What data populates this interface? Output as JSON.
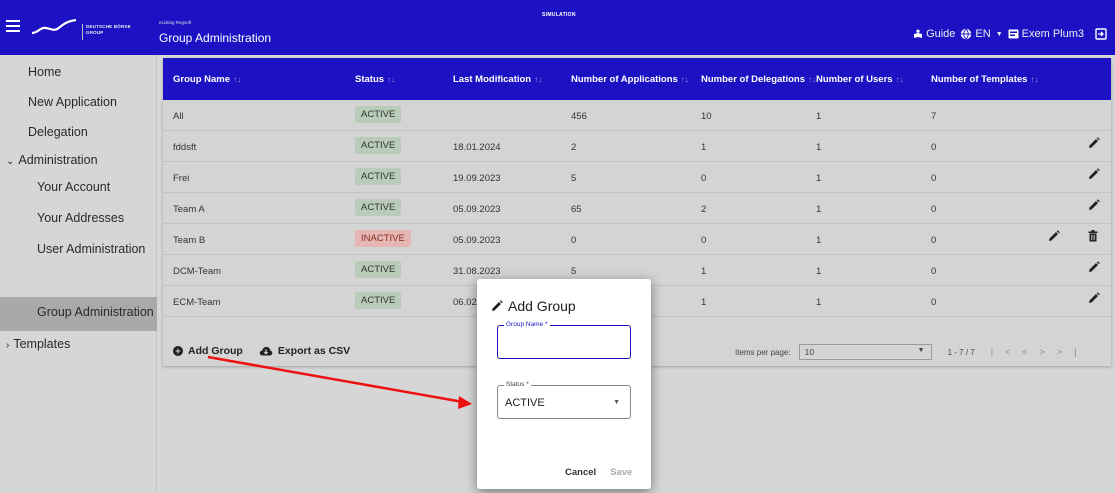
{
  "header": {
    "logo_line1": "DEUTSCHE BÖRSE",
    "logo_line2": "GROUP",
    "app_name": "eListing Regsoft",
    "page_title": "Group Administration",
    "environment": "SIMULATION",
    "guide_label": "Guide",
    "language_label": "EN",
    "user_label": "Exem Plum3",
    "accent_color": "#1c12c4"
  },
  "sidebar": {
    "items": [
      {
        "label": "Home"
      },
      {
        "label": "New Application"
      },
      {
        "label": "Delegation"
      },
      {
        "label": "Administration"
      },
      {
        "label": "Your Account"
      },
      {
        "label": "Your Addresses"
      },
      {
        "label": "User Administration"
      },
      {
        "label": "Group Administration"
      },
      {
        "label": "Templates"
      }
    ],
    "active": "Group Administration"
  },
  "table": {
    "columns": [
      "Group Name",
      "Status",
      "Last Modification",
      "Number of Applications",
      "Number of Delegations",
      "Number of Users",
      "Number of Templates"
    ],
    "rows": [
      {
        "name": "All",
        "status": "ACTIVE",
        "modified": "",
        "applications": "456",
        "delegations": "10",
        "users": "1",
        "templates": "7"
      },
      {
        "name": "fddsft",
        "status": "ACTIVE",
        "modified": "18.01.2024",
        "applications": "2",
        "delegations": "1",
        "users": "1",
        "templates": "0"
      },
      {
        "name": "Frei",
        "status": "ACTIVE",
        "modified": "19.09.2023",
        "applications": "5",
        "delegations": "0",
        "users": "1",
        "templates": "0"
      },
      {
        "name": "Team A",
        "status": "ACTIVE",
        "modified": "05.09.2023",
        "applications": "65",
        "delegations": "2",
        "users": "1",
        "templates": "0"
      },
      {
        "name": "Team B",
        "status": "INACTIVE",
        "modified": "05.09.2023",
        "applications": "0",
        "delegations": "0",
        "users": "1",
        "templates": "0"
      },
      {
        "name": "DCM-Team",
        "status": "ACTIVE",
        "modified": "31.08.2023",
        "applications": "5",
        "delegations": "1",
        "users": "1",
        "templates": "0"
      },
      {
        "name": "ECM-Team",
        "status": "ACTIVE",
        "modified": "06.02.",
        "applications": "",
        "delegations": "1",
        "users": "1",
        "templates": "0"
      }
    ],
    "add_group_label": "Add Group",
    "export_label": "Export as CSV",
    "items_per_page_label": "Items per page:",
    "items_per_page_value": "10",
    "range_label": "1 - 7 / 7"
  },
  "dialog": {
    "title": "Add Group",
    "group_name_label": "Group Name *",
    "group_name_value": "",
    "status_label": "Status *",
    "status_value": "ACTIVE",
    "cancel_label": "Cancel",
    "save_label": "Save"
  }
}
